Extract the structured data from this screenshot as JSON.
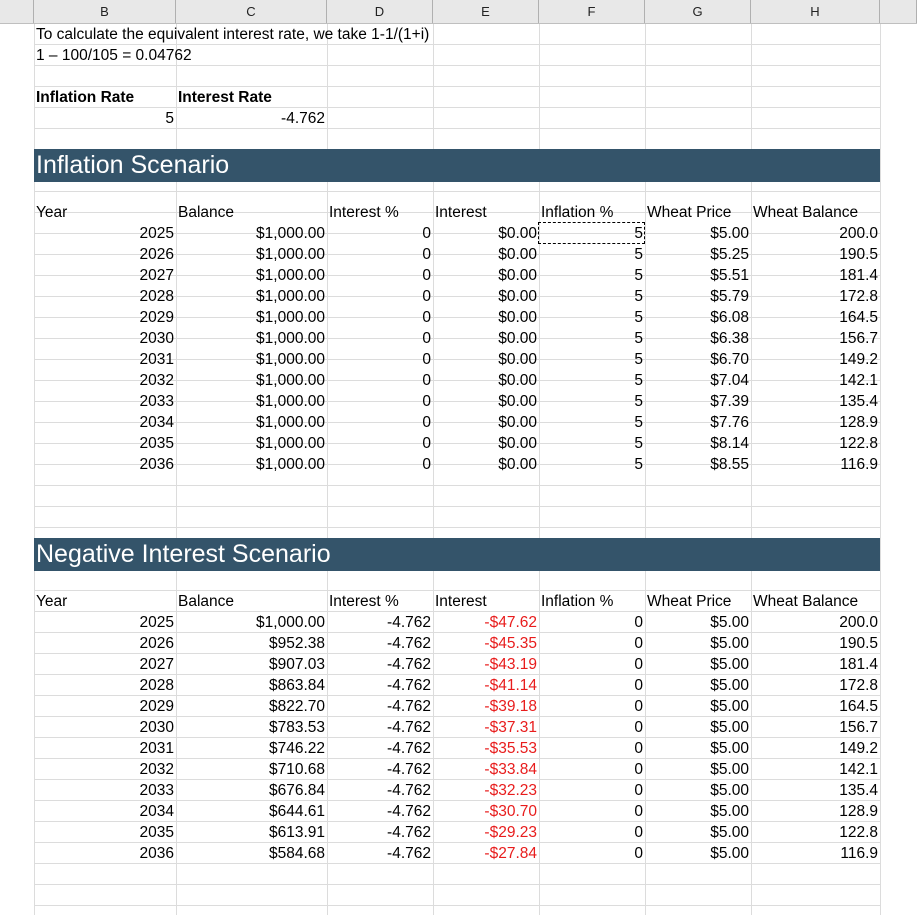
{
  "column_headers": [
    "B",
    "C",
    "D",
    "E",
    "F",
    "G",
    "H"
  ],
  "notes": {
    "line1": "To calculate the equivalent interest rate, we take 1-1/(1+i)",
    "line2": "1 – 100/105 = 0.04762"
  },
  "params": {
    "inflation_label": "Inflation Rate",
    "interest_label": "Interest Rate",
    "inflation_value": "5",
    "interest_value": "-4.762"
  },
  "scenario1": {
    "title": "Inflation Scenario",
    "headers": [
      "Year",
      "Balance",
      "Interest %",
      "Interest",
      "Inflation %",
      "Wheat Price",
      "Wheat Balance"
    ],
    "rows": [
      [
        "2025",
        "$1,000.00",
        "0",
        "$0.00",
        "5",
        "$5.00",
        "200.0"
      ],
      [
        "2026",
        "$1,000.00",
        "0",
        "$0.00",
        "5",
        "$5.25",
        "190.5"
      ],
      [
        "2027",
        "$1,000.00",
        "0",
        "$0.00",
        "5",
        "$5.51",
        "181.4"
      ],
      [
        "2028",
        "$1,000.00",
        "0",
        "$0.00",
        "5",
        "$5.79",
        "172.8"
      ],
      [
        "2029",
        "$1,000.00",
        "0",
        "$0.00",
        "5",
        "$6.08",
        "164.5"
      ],
      [
        "2030",
        "$1,000.00",
        "0",
        "$0.00",
        "5",
        "$6.38",
        "156.7"
      ],
      [
        "2031",
        "$1,000.00",
        "0",
        "$0.00",
        "5",
        "$6.70",
        "149.2"
      ],
      [
        "2032",
        "$1,000.00",
        "0",
        "$0.00",
        "5",
        "$7.04",
        "142.1"
      ],
      [
        "2033",
        "$1,000.00",
        "0",
        "$0.00",
        "5",
        "$7.39",
        "135.4"
      ],
      [
        "2034",
        "$1,000.00",
        "0",
        "$0.00",
        "5",
        "$7.76",
        "128.9"
      ],
      [
        "2035",
        "$1,000.00",
        "0",
        "$0.00",
        "5",
        "$8.14",
        "122.8"
      ],
      [
        "2036",
        "$1,000.00",
        "0",
        "$0.00",
        "5",
        "$8.55",
        "116.9"
      ]
    ]
  },
  "scenario2": {
    "title": "Negative Interest Scenario",
    "headers": [
      "Year",
      "Balance",
      "Interest %",
      "Interest",
      "Inflation %",
      "Wheat Price",
      "Wheat Balance"
    ],
    "rows": [
      [
        "2025",
        "$1,000.00",
        "-4.762",
        "-$47.62",
        "0",
        "$5.00",
        "200.0"
      ],
      [
        "2026",
        "$952.38",
        "-4.762",
        "-$45.35",
        "0",
        "$5.00",
        "190.5"
      ],
      [
        "2027",
        "$907.03",
        "-4.762",
        "-$43.19",
        "0",
        "$5.00",
        "181.4"
      ],
      [
        "2028",
        "$863.84",
        "-4.762",
        "-$41.14",
        "0",
        "$5.00",
        "172.8"
      ],
      [
        "2029",
        "$822.70",
        "-4.762",
        "-$39.18",
        "0",
        "$5.00",
        "164.5"
      ],
      [
        "2030",
        "$783.53",
        "-4.762",
        "-$37.31",
        "0",
        "$5.00",
        "156.7"
      ],
      [
        "2031",
        "$746.22",
        "-4.762",
        "-$35.53",
        "0",
        "$5.00",
        "149.2"
      ],
      [
        "2032",
        "$710.68",
        "-4.762",
        "-$33.84",
        "0",
        "$5.00",
        "142.1"
      ],
      [
        "2033",
        "$676.84",
        "-4.762",
        "-$32.23",
        "0",
        "$5.00",
        "135.4"
      ],
      [
        "2034",
        "$644.61",
        "-4.762",
        "-$30.70",
        "0",
        "$5.00",
        "128.9"
      ],
      [
        "2035",
        "$613.91",
        "-4.762",
        "-$29.23",
        "0",
        "$5.00",
        "122.8"
      ],
      [
        "2036",
        "$584.68",
        "-4.762",
        "-$27.84",
        "0",
        "$5.00",
        "116.9"
      ]
    ]
  },
  "colors": {
    "banner": "#34546a",
    "banner_text": "#ffffff",
    "negative": "#e81c1c",
    "gridline": "#dcdcdc"
  }
}
